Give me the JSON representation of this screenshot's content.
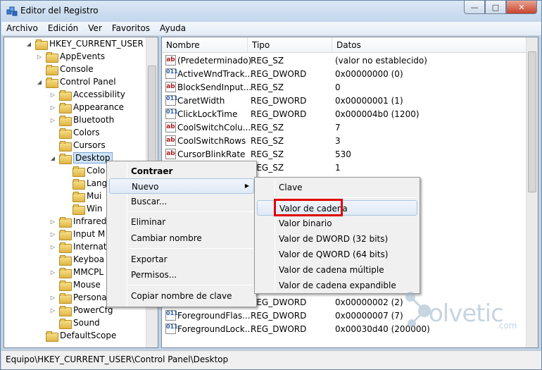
{
  "window": {
    "title": "Editor del Registro",
    "minimize": "—",
    "maximize": "□",
    "close": "✕"
  },
  "menubar": [
    "Archivo",
    "Edición",
    "Ver",
    "Favoritos",
    "Ayuda"
  ],
  "tree": {
    "root": "HKEY_CURRENT_USER",
    "items": [
      {
        "label": "AppEvents",
        "expander": "▷"
      },
      {
        "label": "Console",
        "expander": ""
      },
      {
        "label": "Control Panel",
        "expander": "◢"
      },
      {
        "label": "Accessibility",
        "expander": "▷"
      },
      {
        "label": "Appearance",
        "expander": "▷"
      },
      {
        "label": "Bluetooth",
        "expander": "▷"
      },
      {
        "label": "Colors",
        "expander": ""
      },
      {
        "label": "Cursors",
        "expander": ""
      },
      {
        "label": "Desktop",
        "expander": "◢"
      },
      {
        "label": "Colo",
        "expander": ""
      },
      {
        "label": "Lang",
        "expander": ""
      },
      {
        "label": "Mui",
        "expander": ""
      },
      {
        "label": "Win",
        "expander": ""
      },
      {
        "label": "Infrared",
        "expander": "▷"
      },
      {
        "label": "Input M",
        "expander": "▷"
      },
      {
        "label": "Internat",
        "expander": "▷"
      },
      {
        "label": "Keyboa",
        "expander": ""
      },
      {
        "label": "MMCPL",
        "expander": "▷"
      },
      {
        "label": "Mouse",
        "expander": ""
      },
      {
        "label": "Persona",
        "expander": "▷"
      },
      {
        "label": "PowerCfg",
        "expander": "▷"
      },
      {
        "label": "Sound",
        "expander": ""
      },
      {
        "label": "DefaultScope",
        "expander": ""
      }
    ]
  },
  "list": {
    "headers": [
      "Nombre",
      "Tipo",
      "Datos"
    ],
    "rows": [
      {
        "icon": "ab",
        "name": "(Predeterminado)",
        "type": "REG_SZ",
        "data": "(valor no establecido)"
      },
      {
        "icon": "011",
        "name": "ActiveWndTrack...",
        "type": "REG_DWORD",
        "data": "0x00000000 (0)"
      },
      {
        "icon": "ab",
        "name": "BlockSendInput...",
        "type": "REG_SZ",
        "data": "0"
      },
      {
        "icon": "011",
        "name": "CaretWidth",
        "type": "REG_DWORD",
        "data": "0x00000001 (1)"
      },
      {
        "icon": "011",
        "name": "ClickLockTime",
        "type": "REG_DWORD",
        "data": "0x000004b0 (1200)"
      },
      {
        "icon": "ab",
        "name": "CoolSwitchColu...",
        "type": "REG_SZ",
        "data": "7"
      },
      {
        "icon": "ab",
        "name": "CoolSwitchRows",
        "type": "REG_SZ",
        "data": "3"
      },
      {
        "icon": "ab",
        "name": "CursorBlinkRate",
        "type": "REG_SZ",
        "data": "530"
      },
      {
        "icon": "",
        "name": "",
        "type": "REG_SZ",
        "data": "1"
      }
    ],
    "bottom_rows": [
      {
        "icon": "",
        "name": "",
        "type": "REG_DWORD",
        "data": "0x00000002 (2)"
      },
      {
        "icon": "011",
        "name": "ForegroundFlas...",
        "type": "REG_DWORD",
        "data": "0x00000007 (7)"
      },
      {
        "icon": "011",
        "name": "ForegroundLock...",
        "type": "REG_DWORD",
        "data": "0x00030d40 (200000)"
      }
    ]
  },
  "context_menu": {
    "collapse": "Contraer",
    "new": "Nuevo",
    "find": "Buscar...",
    "delete": "Eliminar",
    "rename": "Cambiar nombre",
    "export": "Exportar",
    "permissions": "Permisos...",
    "copy_key": "Copiar nombre de clave"
  },
  "submenu": {
    "items": [
      "Clave",
      "Valor de cadena",
      "Valor binario",
      "Valor de DWORD (32 bits)",
      "Valor de QWORD (64 bits)",
      "Valor de cadena múltiple",
      "Valor de cadena expandible"
    ],
    "highlighted": "Valor de cadena",
    "highlight_color": "#e00000"
  },
  "statusbar": {
    "path": "Equipo\\HKEY_CURRENT_USER\\Control Panel\\Desktop"
  },
  "watermark": {
    "text": "olvetic",
    "domain": ".com"
  }
}
